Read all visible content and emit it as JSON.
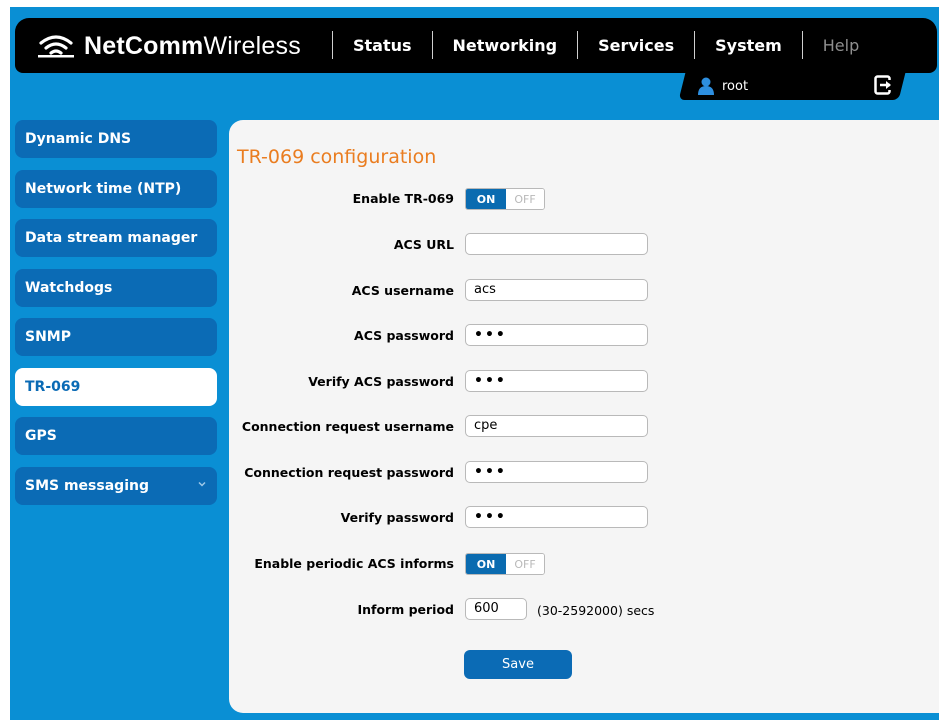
{
  "brand": {
    "name_bold": "NetComm",
    "name_regular": "Wireless"
  },
  "nav": [
    "Status",
    "Networking",
    "Services",
    "System",
    "Help"
  ],
  "user": {
    "name": "root"
  },
  "sidebar": {
    "items": [
      {
        "label": "Dynamic DNS"
      },
      {
        "label": "Network time (NTP)"
      },
      {
        "label": "Data stream manager"
      },
      {
        "label": "Watchdogs"
      },
      {
        "label": "SNMP"
      },
      {
        "label": "TR-069"
      },
      {
        "label": "GPS"
      },
      {
        "label": "SMS messaging"
      }
    ],
    "active": "TR-069"
  },
  "page": {
    "title": "TR-069 configuration"
  },
  "form": {
    "enable_tr069": {
      "label": "Enable TR-069",
      "on": "ON",
      "off": "OFF",
      "value": "ON"
    },
    "acs_url": {
      "label": "ACS URL",
      "value": ""
    },
    "acs_username": {
      "label": "ACS username",
      "value": "acs"
    },
    "acs_password": {
      "label": "ACS password",
      "value": "•••"
    },
    "verify_acs_password": {
      "label": "Verify ACS password",
      "value": "•••"
    },
    "conn_req_username": {
      "label": "Connection request username",
      "value": "cpe"
    },
    "conn_req_password": {
      "label": "Connection request password",
      "value": "•••"
    },
    "verify_password": {
      "label": "Verify password",
      "value": "•••"
    },
    "enable_periodic": {
      "label": "Enable periodic ACS informs",
      "on": "ON",
      "off": "OFF",
      "value": "ON"
    },
    "inform_period": {
      "label": "Inform period",
      "value": "600",
      "unit": "(30-2592000) secs"
    },
    "save_label": "Save"
  },
  "colors": {
    "accent_blue": "#0b6bb5",
    "title_orange": "#ea7d20",
    "background_blue": "#0a8fd4"
  }
}
